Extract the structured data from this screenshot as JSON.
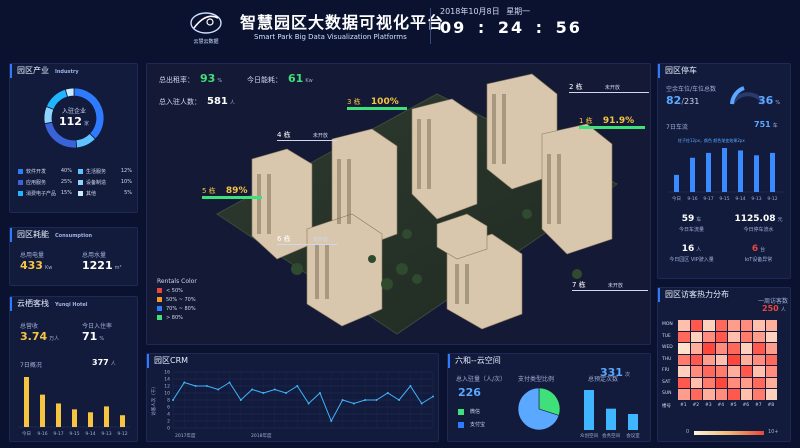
{
  "header": {
    "logo_text": "云慧云数据",
    "title": "智慧园区大数据可视化平台",
    "subtitle": "Smart Park Big Data Visualization Platforms",
    "date": "2018年10月8日",
    "weekday": "星期一",
    "time_h": "09",
    "time_m": "24",
    "time_s": "56",
    "sep": ":"
  },
  "industry": {
    "title": "园区产业",
    "title_en": "Industry",
    "center_label": "入驻企业",
    "center_value": "112",
    "center_unit": "家",
    "legend": [
      {
        "name": "软件开发",
        "pct": "40%",
        "color": "#2f7bff"
      },
      {
        "name": "生活服务",
        "pct": "12%",
        "color": "#5ec3ff"
      },
      {
        "name": "应用服务",
        "pct": "25%",
        "color": "#3a62d9"
      },
      {
        "name": "设备制造",
        "pct": "10%",
        "color": "#8fd4ff"
      },
      {
        "name": "消费电子产品",
        "pct": "15%",
        "color": "#1fb6ff"
      },
      {
        "name": "其他",
        "pct": "5%",
        "color": "#c9ecff"
      }
    ]
  },
  "consumption": {
    "title": "园区耗能",
    "title_en": "Consumption",
    "power_label": "总用电量",
    "power_value": "433",
    "power_unit": "Kw",
    "water_label": "总用水量",
    "water_value": "1221",
    "water_unit": "m³"
  },
  "hotel": {
    "title": "云栖客栈",
    "title_en": "Yunqi Hotel",
    "revenue_label": "总营收",
    "revenue_value": "3.74",
    "revenue_unit": "万人",
    "checkin_label": "今日入住率",
    "checkin_value": "71",
    "checkin_unit": "%",
    "week_label": "7日概况",
    "week_total": "377",
    "week_unit": "人",
    "bars": {
      "categories": [
        "今日",
        "9-16",
        "9-17",
        "9-15",
        "9-14",
        "9-13",
        "9-12"
      ],
      "values": [
        85,
        55,
        40,
        30,
        25,
        35,
        20
      ]
    }
  },
  "top_stats": {
    "rent_label": "总出租率：",
    "rent_value": "93",
    "rent_unit": "%",
    "energy_label": "今日能耗：",
    "energy_value": "61",
    "energy_unit": "Kw",
    "tenants_label": "总入驻人数：",
    "tenants_value": "581",
    "tenants_unit": "人"
  },
  "buildings": [
    {
      "name": "2 栋",
      "status": "未开放",
      "pct": ""
    },
    {
      "name": "3 栋",
      "status": "",
      "pct": "100%"
    },
    {
      "name": "1 栋",
      "status": "",
      "pct": "91.9%"
    },
    {
      "name": "4 栋",
      "status": "未开放",
      "pct": ""
    },
    {
      "name": "5 栋",
      "status": "",
      "pct": "89%"
    },
    {
      "name": "6 栋",
      "status": "未开放",
      "pct": ""
    },
    {
      "name": "7 栋",
      "status": "未开放",
      "pct": ""
    }
  ],
  "rentals_legend": {
    "title": "Rentals Color",
    "items": [
      {
        "label": "< 50%",
        "color": "#e8473c"
      },
      {
        "label": "50% ~ 70%",
        "color": "#f39a2c"
      },
      {
        "label": "70% ~ 80%",
        "color": "#2f7bff"
      },
      {
        "label": "> 80%",
        "color": "#3fe07a"
      }
    ]
  },
  "parking": {
    "title": "园区停车",
    "space_label": "空余车位/车位总数",
    "space_free": "82",
    "space_total": "231",
    "ratio": "36",
    "ratio_unit": "%",
    "week_label": "7日车流",
    "week_value": "751",
    "week_unit": "车",
    "note": "柱子柱12px，颜色 颜色渐变效果2px",
    "bars": {
      "categories": [
        "今日",
        "9-16",
        "9-17",
        "9-15",
        "9-14",
        "9-13",
        "9-12"
      ],
      "values": [
        35,
        70,
        80,
        90,
        85,
        75,
        80
      ]
    },
    "stats": [
      {
        "value": "59",
        "unit": "车",
        "label": "今日车流量"
      },
      {
        "value": "1125.08",
        "unit": "元",
        "label": "今日停车流水"
      },
      {
        "value": "16",
        "unit": "人",
        "label": "今日园区 VIP驶入量"
      },
      {
        "value": "6",
        "unit": "台",
        "label": "IoT设备异常"
      }
    ]
  },
  "heatmap": {
    "title": "园区访客热力分布",
    "weekly_label": "一周访客数",
    "weekly_value": "250",
    "weekly_unit": "人",
    "days": [
      "MON",
      "TUE",
      "WED",
      "THU",
      "FRI",
      "SAT",
      "SUN"
    ],
    "cols": [
      "楼号",
      "#1",
      "#2",
      "#3",
      "#4",
      "#5",
      "#6",
      "#7",
      "#8"
    ],
    "scale_min": "0",
    "scale_max": "10+",
    "values": [
      [
        3,
        9,
        2,
        8,
        5,
        6,
        3,
        4
      ],
      [
        8,
        2,
        6,
        9,
        3,
        7,
        5,
        2
      ],
      [
        1,
        4,
        10,
        6,
        8,
        2,
        9,
        5
      ],
      [
        7,
        9,
        5,
        3,
        10,
        4,
        6,
        8
      ],
      [
        2,
        6,
        8,
        7,
        4,
        9,
        3,
        6
      ],
      [
        9,
        3,
        7,
        10,
        6,
        5,
        8,
        4
      ],
      [
        5,
        8,
        4,
        6,
        9,
        3,
        7,
        2
      ]
    ]
  },
  "crm": {
    "title": "园区CRM",
    "ylabel": "访客人次（千）",
    "ylim": [
      0,
      16
    ],
    "yticks": [
      "0",
      "2",
      "4",
      "6",
      "8",
      "10",
      "12",
      "14",
      "16"
    ],
    "xticks": [
      "2017年度",
      "2018年度"
    ],
    "values": [
      8,
      13,
      12,
      12,
      11,
      13,
      8,
      11,
      10,
      11,
      10,
      12,
      7,
      10,
      2,
      8,
      7,
      8,
      8,
      10,
      8,
      12,
      7,
      9
    ]
  },
  "cowork": {
    "title": "六和--云空间",
    "members_label": "总入驻量（人/次）",
    "members_value": "226",
    "pie_label": "支付类型比例",
    "sessions_label": "总预定次数",
    "sessions_value": "331",
    "sessions_unit": "次",
    "legend": [
      {
        "label": "微信",
        "color": "#3fe07a"
      },
      {
        "label": "支付宝",
        "color": "#2f7bff"
      }
    ],
    "pie": [
      {
        "name": "微信",
        "value": 30,
        "color": "#3fe07a"
      },
      {
        "name": "支付宝",
        "value": 70,
        "color": "#5aa8ff"
      }
    ],
    "bars": {
      "categories": [
        "众创空间",
        "会务空间",
        "会议室"
      ],
      "values": [
        15,
        8,
        6
      ]
    }
  }
}
